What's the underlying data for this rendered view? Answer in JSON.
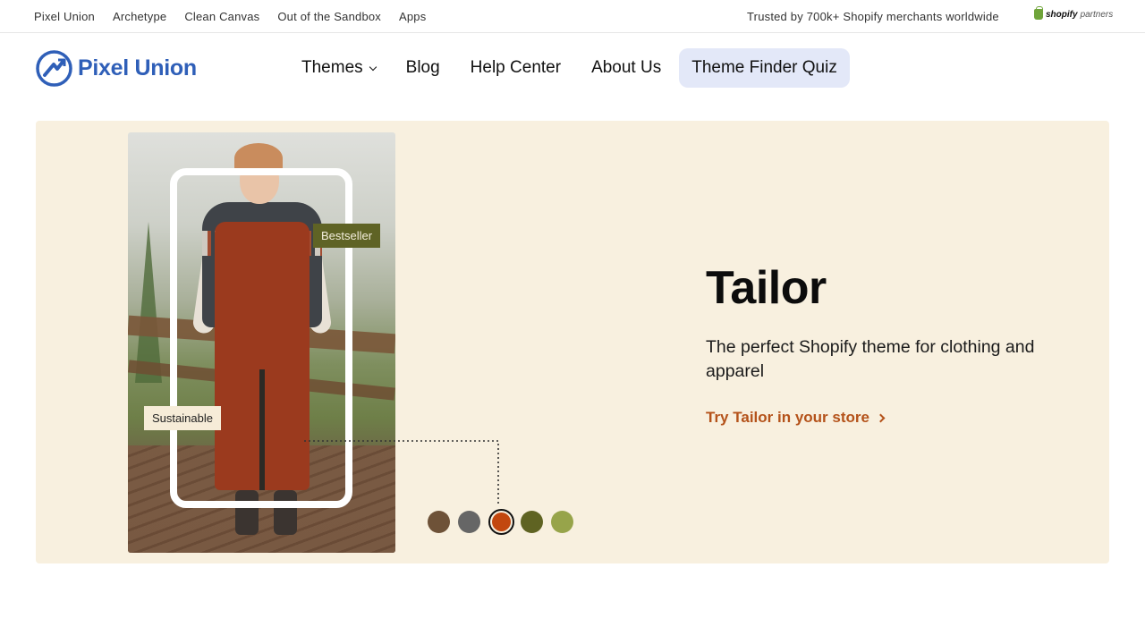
{
  "topbar": {
    "links": [
      "Pixel Union",
      "Archetype",
      "Clean Canvas",
      "Out of the Sandbox",
      "Apps"
    ],
    "trusted_text": "Trusted by 700k+ Shopify merchants worldwide",
    "partner_badge": {
      "brand": "shopify",
      "suffix": "partners",
      "icon": "shopify-bag-icon"
    }
  },
  "header": {
    "logo_text": "Pixel Union",
    "nav": {
      "themes": "Themes",
      "blog": "Blog",
      "help": "Help Center",
      "about": "About Us",
      "quiz": "Theme Finder Quiz"
    }
  },
  "hero": {
    "title": "Tailor",
    "subtitle": "The perfect Shopify theme for clothing and apparel",
    "cta": "Try Tailor in your store",
    "tags": {
      "bestseller": "Bestseller",
      "sustainable": "Sustainable"
    },
    "swatches": [
      {
        "color": "#6e5238",
        "selected": false
      },
      {
        "color": "#666666",
        "selected": false
      },
      {
        "color": "#c2470f",
        "selected": true
      },
      {
        "color": "#5f6322",
        "selected": false
      },
      {
        "color": "#97a44a",
        "selected": false
      }
    ]
  },
  "colors": {
    "brand_blue": "#2f5fb8",
    "hero_bg": "#f8f0df",
    "cta": "#b4521a",
    "quiz_bg": "#e3e8f8"
  }
}
